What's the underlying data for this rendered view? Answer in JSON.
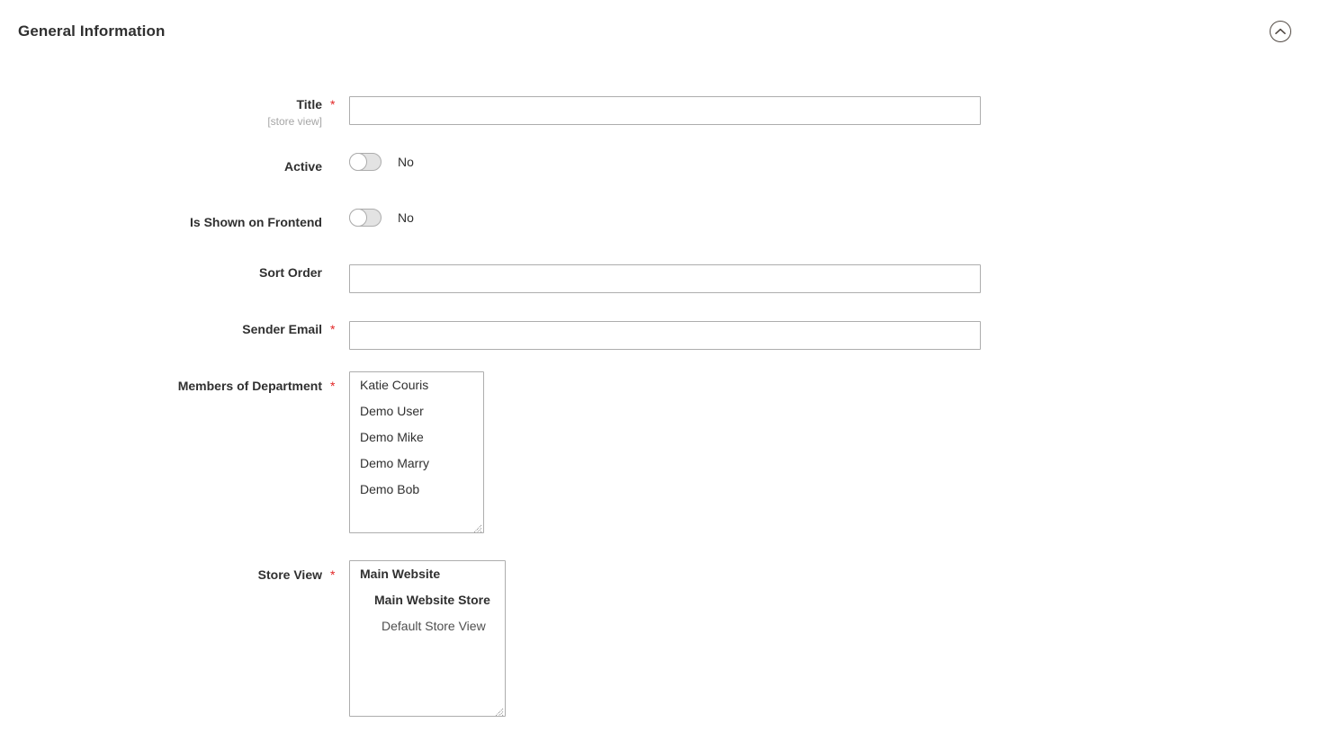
{
  "section": {
    "title": "General Information",
    "collapse_icon": "chevron-up-circle-icon"
  },
  "fields": {
    "title": {
      "label": "Title",
      "note": "[store view]",
      "required": true,
      "value": "",
      "placeholder": ""
    },
    "active": {
      "label": "Active",
      "required": false,
      "state_label": "No",
      "checked": false
    },
    "is_shown_on_frontend": {
      "label": "Is Shown on Frontend",
      "required": false,
      "state_label": "No",
      "checked": false
    },
    "sort_order": {
      "label": "Sort Order",
      "required": false,
      "value": "",
      "placeholder": ""
    },
    "sender_email": {
      "label": "Sender Email",
      "required": true,
      "value": "",
      "placeholder": ""
    },
    "members_of_department": {
      "label": "Members of Department",
      "required": true,
      "options": [
        "Katie Couris",
        "Demo User",
        "Demo Mike",
        "Demo Marry",
        "Demo Bob"
      ]
    },
    "store_view": {
      "label": "Store View",
      "required": true,
      "options": [
        {
          "label": "Main Website",
          "level": 0
        },
        {
          "label": "Main Website Store",
          "level": 1
        },
        {
          "label": "Default Store View",
          "level": 2
        }
      ]
    }
  },
  "colors": {
    "required_star": "#e22626",
    "label_text": "#303030",
    "note_text": "#a6a6a6",
    "input_border": "#adadad",
    "background": "#ffffff"
  }
}
